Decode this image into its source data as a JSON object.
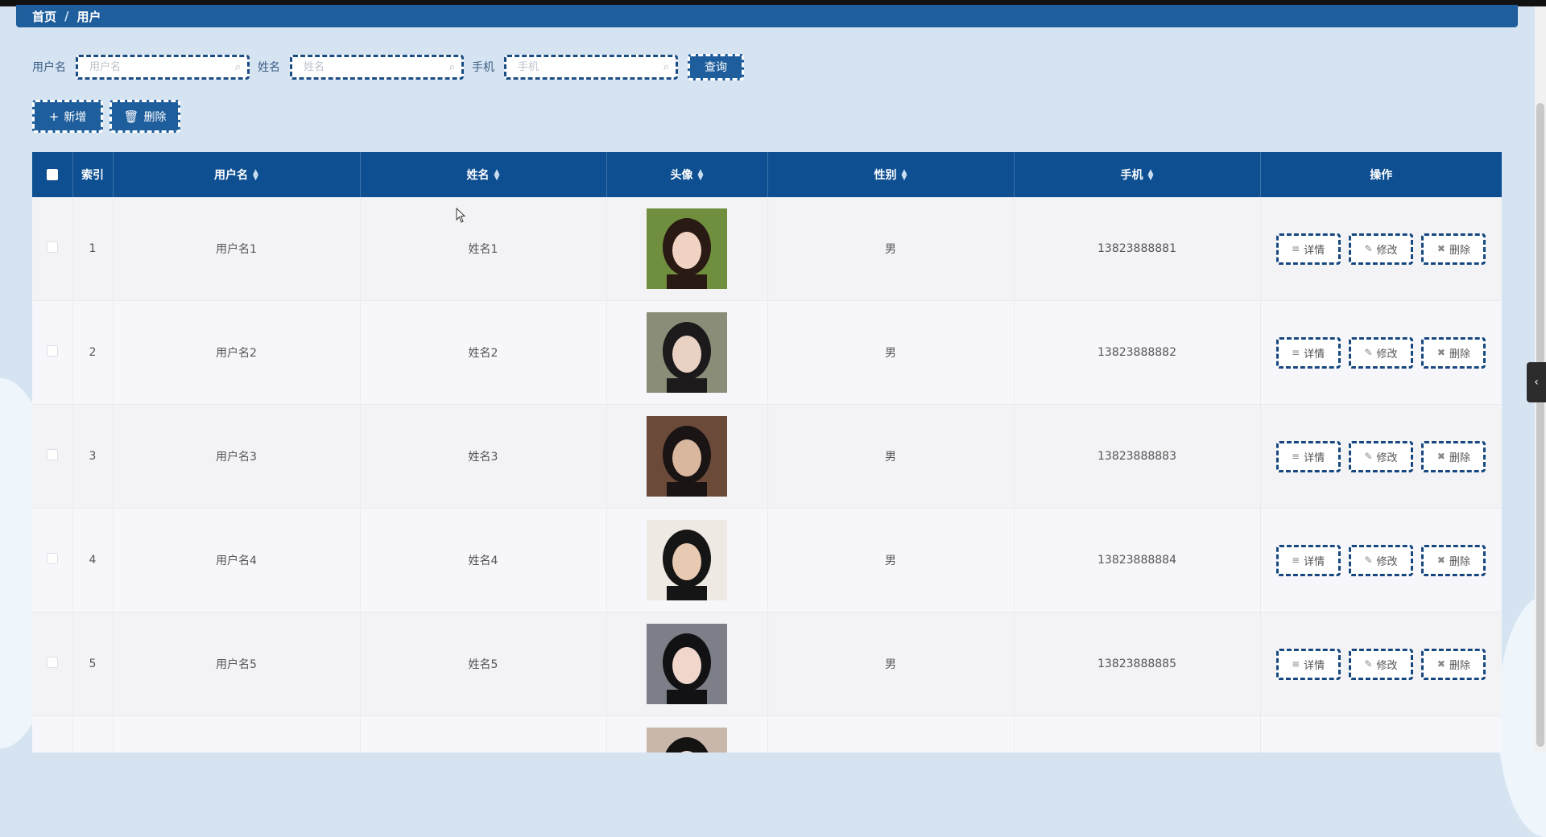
{
  "breadcrumb": {
    "home": "首页",
    "separator": "/",
    "current": "用户"
  },
  "search": {
    "username_label": "用户名",
    "username_placeholder": "用户名",
    "name_label": "姓名",
    "name_placeholder": "姓名",
    "phone_label": "手机",
    "phone_placeholder": "手机",
    "query_button": "查询"
  },
  "toolbar": {
    "add_label": "新增",
    "delete_label": "删除"
  },
  "table": {
    "headers": {
      "index": "索引",
      "username": "用户名",
      "name": "姓名",
      "avatar": "头像",
      "gender": "性别",
      "phone": "手机",
      "actions": "操作"
    },
    "actions": {
      "detail": "详情",
      "edit": "修改",
      "delete": "删除"
    },
    "rows": [
      {
        "index": "1",
        "username": "用户名1",
        "name": "姓名1",
        "gender": "男",
        "phone": "13823888881"
      },
      {
        "index": "2",
        "username": "用户名2",
        "name": "姓名2",
        "gender": "男",
        "phone": "13823888882"
      },
      {
        "index": "3",
        "username": "用户名3",
        "name": "姓名3",
        "gender": "男",
        "phone": "13823888883"
      },
      {
        "index": "4",
        "username": "用户名4",
        "name": "姓名4",
        "gender": "男",
        "phone": "13823888884"
      },
      {
        "index": "5",
        "username": "用户名5",
        "name": "姓名5",
        "gender": "男",
        "phone": "13823888885"
      },
      {
        "index": "",
        "username": "",
        "name": "",
        "gender": "",
        "phone": ""
      }
    ]
  },
  "colors": {
    "primary": "#1f5e9c",
    "header": "#0e4f92",
    "background": "#d6e4f2"
  },
  "icons": {
    "search": "search-icon",
    "plus": "plus-icon",
    "trash": "trash-icon",
    "doc": "document-icon",
    "edit": "edit-icon",
    "collapse": "chevron-left-icon"
  }
}
